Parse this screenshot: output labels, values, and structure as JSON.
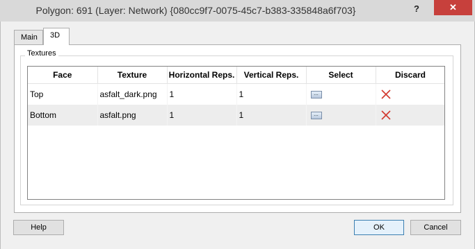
{
  "window": {
    "title": "Polygon: 691 (Layer: Network) {080cc9f7-0075-45c7-b383-335848a6f703}",
    "help_glyph": "?",
    "close_glyph": "✕"
  },
  "tabs": [
    {
      "label": "Main",
      "selected": false
    },
    {
      "label": "3D",
      "selected": true
    }
  ],
  "textures": {
    "group_label": "Textures",
    "columns": [
      "Face",
      "Texture",
      "Horizontal Reps.",
      "Vertical Reps.",
      "Select",
      "Discard"
    ],
    "rows": [
      {
        "face": "Top",
        "texture": "asfalt_dark.png",
        "h_reps": "1",
        "v_reps": "1",
        "select": "...",
        "discard_icon": "red-x-icon"
      },
      {
        "face": "Bottom",
        "texture": "asfalt.png",
        "h_reps": "1",
        "v_reps": "1",
        "select": "...",
        "discard_icon": "red-x-icon"
      }
    ]
  },
  "buttons": {
    "help": "Help",
    "ok": "OK",
    "cancel": "Cancel"
  },
  "colors": {
    "close_button": "#c7403c",
    "discard_x": "#d2382e"
  }
}
